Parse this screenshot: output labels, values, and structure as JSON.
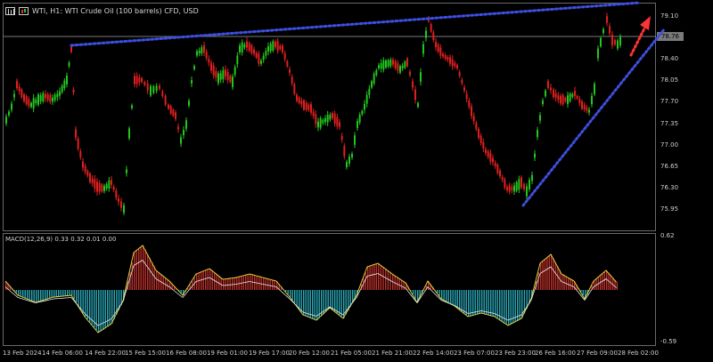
{
  "chart": {
    "symbol_icons": [
      "bar-chart-icon",
      "candlestick-icon"
    ],
    "title": "WTI, H1:  WTI Crude Oil (100 barrels) CFD, USD",
    "price_axis": [
      "79.10",
      "78.40",
      "78.05",
      "77.70",
      "77.35",
      "77.00",
      "76.65",
      "76.30",
      "75.95"
    ],
    "current_price": "78.76",
    "macd": {
      "label": "MACD(12,26,9) 0.33 0.32 0.01 0.00",
      "axis_top": "0.62",
      "axis_bottom": "-0.59"
    },
    "time_axis": [
      "13 Feb 2024",
      "14 Feb 06:00",
      "14 Feb 22:00",
      "15 Feb 15:00",
      "16 Feb 08:00",
      "19 Feb 01:00",
      "19 Feb 17:00",
      "20 Feb 12:00",
      "21 Feb 05:00",
      "21 Feb 21:00",
      "22 Feb 14:00",
      "23 Feb 07:00",
      "23 Feb 23:00",
      "26 Feb 16:00",
      "27 Feb 09:00",
      "28 Feb 02:00"
    ],
    "colors": {
      "bull": "#22c71e",
      "bear": "#e01f1f",
      "trendline": "#3d4fe0",
      "arrow": "#ff3333",
      "macd_pos": "#c0312b",
      "macd_neg": "#2aa9b8",
      "macd_line": "#f0e040",
      "signal_line": "#e8e8e8"
    }
  }
}
